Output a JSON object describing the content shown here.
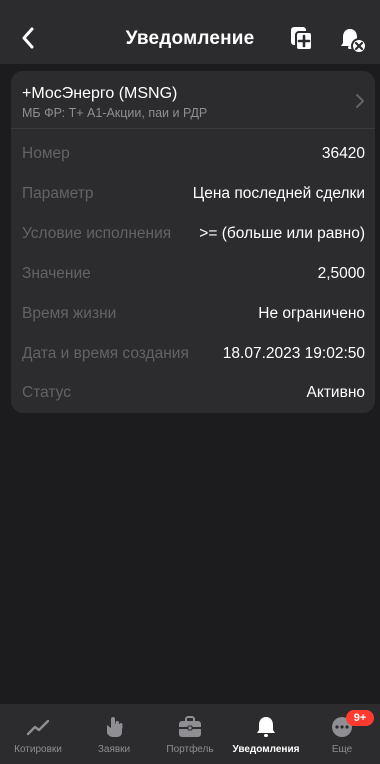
{
  "header": {
    "title": "Уведомление",
    "back_icon": "chevron-left-icon",
    "copy_icon": "copy-add-icon",
    "delete_icon": "bell-off-icon"
  },
  "instrument": {
    "name": "+МосЭнерго (MSNG)",
    "market": "МБ ФР: Т+ А1-Акции, паи и РДР"
  },
  "details": [
    {
      "label": "Номер",
      "value": "36420"
    },
    {
      "label": "Параметр",
      "value": "Цена последней сделки"
    },
    {
      "label": "Условие исполнения",
      "value": ">= (больше или равно)"
    },
    {
      "label": "Значение",
      "value": "2,5000"
    },
    {
      "label": "Время жизни",
      "value": "Не ограничено"
    },
    {
      "label": "Дата и время создания",
      "value": "18.07.2023 19:02:50"
    },
    {
      "label": "Статус",
      "value": "Активно"
    }
  ],
  "tabbar": {
    "items": [
      {
        "label": "Котировки",
        "icon": "chart-line-icon",
        "active": false
      },
      {
        "label": "Заявки",
        "icon": "hand-pointer-icon",
        "active": false
      },
      {
        "label": "Портфель",
        "icon": "briefcase-icon",
        "active": false
      },
      {
        "label": "Уведомления",
        "icon": "bell-icon",
        "active": true
      },
      {
        "label": "Еще",
        "icon": "more-icon",
        "active": false,
        "badge": "9+"
      }
    ]
  },
  "colors": {
    "background": "#1c1c1e",
    "surface": "#2c2c2e",
    "muted_text": "#636366",
    "badge": "#ff3b30"
  }
}
